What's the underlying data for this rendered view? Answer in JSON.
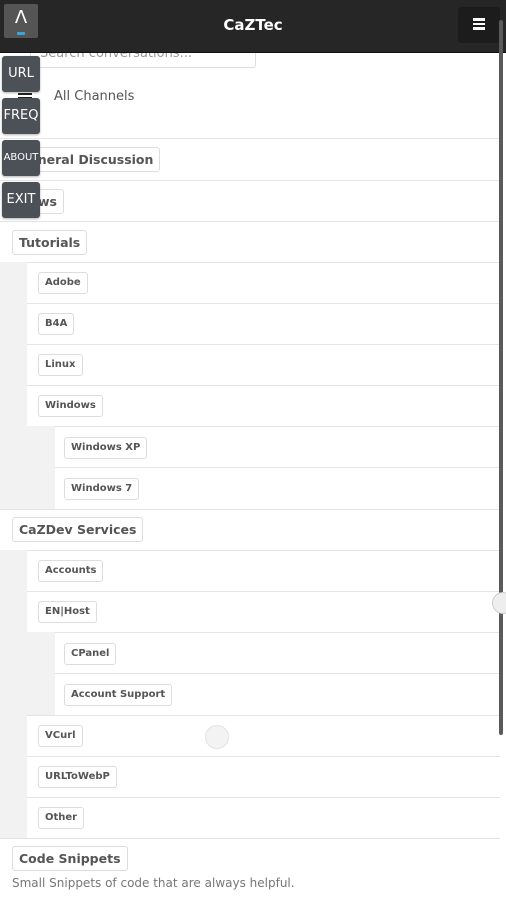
{
  "header": {
    "title": "CaZTec",
    "up_icon": "^",
    "menu_icon": "hamburger-icon"
  },
  "search": {
    "placeholder": "Search conversations..."
  },
  "all_channels": "All Channels",
  "side_buttons": [
    "URL",
    "FREQ",
    "ABOUT",
    "EXIT"
  ],
  "channels": {
    "general": "General Discussion",
    "news": "News",
    "tutorials": {
      "label": "Tutorials",
      "children": [
        "Adobe",
        "B4A",
        "Linux",
        "Windows"
      ],
      "windows_children": [
        "Windows XP",
        "Windows 7"
      ]
    },
    "services": {
      "label": "CaZDev Services",
      "children": [
        "Accounts",
        "EN|Host"
      ],
      "enhost_children": [
        "CPanel",
        "Account Support"
      ],
      "more": [
        "VCurl",
        "URLToWebP",
        "Other"
      ]
    },
    "code": {
      "label": "Code Snippets",
      "description": "Small Snippets of code that are always helpful."
    }
  }
}
